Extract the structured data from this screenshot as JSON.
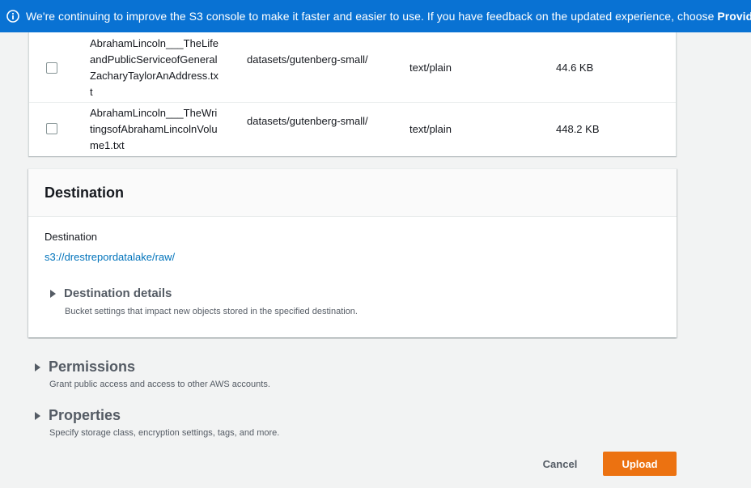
{
  "banner": {
    "text": "We're continuing to improve the S3 console to make it faster and easier to use. If you have feedback on the updated experience, choose ",
    "link_text": "Provide feedback",
    "icon": "info-icon",
    "color": "#0972d3"
  },
  "files": {
    "rows": [
      {
        "name": "AbrahamLincoln___TheLifeandPublicServiceofGeneralZacharyTaylorAnAddress.txt",
        "folder": "datasets/gutenberg-small/",
        "type": "text/plain",
        "size": "44.6 KB"
      },
      {
        "name": "AbrahamLincoln___TheWritingsofAbrahamLincolnVolume1.txt",
        "folder": "datasets/gutenberg-small/",
        "type": "text/plain",
        "size": "448.2 KB"
      }
    ]
  },
  "destination": {
    "title": "Destination",
    "label": "Destination",
    "link": "s3://drestrepordatalake/raw/",
    "details": {
      "title": "Destination details",
      "description": "Bucket settings that impact new objects stored in the specified destination."
    }
  },
  "permissions": {
    "title": "Permissions",
    "description": "Grant public access and access to other AWS accounts."
  },
  "properties": {
    "title": "Properties",
    "description": "Specify storage class, encryption settings, tags, and more."
  },
  "footer": {
    "cancel_label": "Cancel",
    "upload_label": "Upload",
    "upload_color": "#ec7211"
  }
}
